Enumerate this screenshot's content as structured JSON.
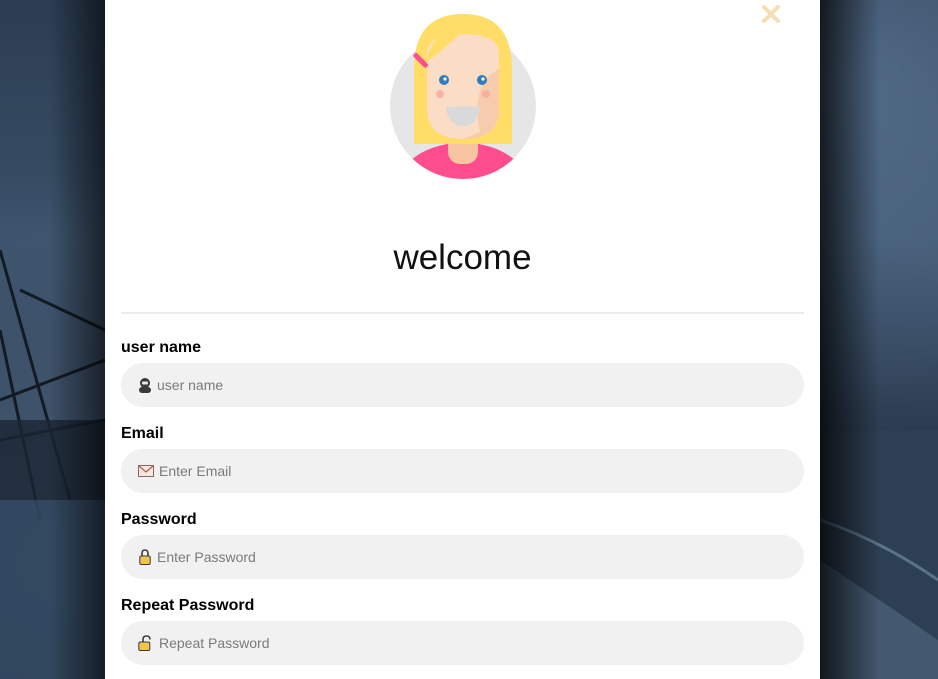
{
  "modal": {
    "welcome_text": "welcome",
    "close_icon": "close-x-icon"
  },
  "form": {
    "username": {
      "label": "user name",
      "placeholder": "user name",
      "icon": "user-icon"
    },
    "email": {
      "label": "Email",
      "placeholder": "Enter Email",
      "icon": "envelope-icon"
    },
    "password": {
      "label": "Password",
      "placeholder": "Enter Password",
      "icon": "lock-icon"
    },
    "repeat_password": {
      "label": "Repeat Password",
      "placeholder": "Repeat Password",
      "icon": "lock-open-icon"
    }
  },
  "colors": {
    "close": "#f5deb3",
    "field_bg": "#f1f1f1",
    "avatar_hair": "#ffdd67",
    "avatar_shirt": "#ff4d8d",
    "avatar_circle": "#e6e6e6"
  }
}
